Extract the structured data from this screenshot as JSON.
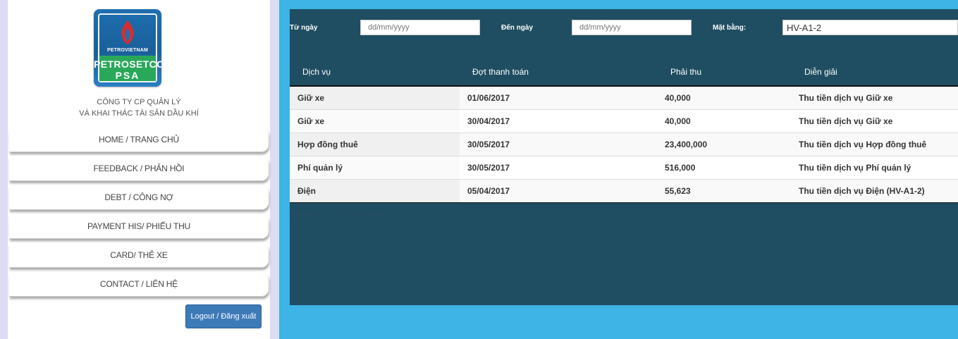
{
  "logo": {
    "brand_small": "PETROVIETNAM",
    "brand_main": "PETROSETCO",
    "brand_psa": "PSA"
  },
  "company": {
    "line1": "CÔNG TY CP QUẢN LÝ",
    "line2": "VÀ KHAI THÁC TÀI SẢN DẦU KHÍ"
  },
  "menu": {
    "items": [
      {
        "label": "HOME / TRANG CHỦ"
      },
      {
        "label": "FEEDBACK / PHẢN HỒI"
      },
      {
        "label": "DEBT / CÔNG NỢ"
      },
      {
        "label": "PAYMENT HIS/ PHIẾU THU"
      },
      {
        "label": "CARD/ THẺ XE"
      },
      {
        "label": "CONTACT / LIÊN HỆ"
      }
    ],
    "logout_label": "Logout / Đăng xuất"
  },
  "filters": {
    "from_label": "Từ ngày",
    "from_placeholder": "dd/mm/yyyy",
    "to_label": "Đến ngày",
    "to_placeholder": "dd/mm/yyyy",
    "unit_label": "Mặt bằng:",
    "unit_value": "HV-A1-2"
  },
  "table": {
    "columns": [
      "Dịch vụ",
      "Đợt thanh toán",
      "Phải thu",
      "Diễn giải"
    ],
    "rows": [
      [
        "Giữ xe",
        "01/06/2017",
        "40,000",
        "Thu tiền dịch vụ Giữ xe"
      ],
      [
        "Giữ xe",
        "30/04/2017",
        "40,000",
        "Thu tiền dịch vụ Giữ xe"
      ],
      [
        "Hợp đồng thuê",
        "30/05/2017",
        "23,400,000",
        "Thu tiền dịch vụ Hợp đồng thuê"
      ],
      [
        "Phí quản lý",
        "30/05/2017",
        "516,000",
        "Thu tiền dịch vụ Phí quản lý"
      ],
      [
        "Điện",
        "05/04/2017",
        "55,623",
        "Thu tiền dịch vụ Điện (HV-A1-2)"
      ]
    ],
    "info": "Showing 1 to 5 of 5 entries"
  },
  "colors": {
    "background": "#3eb3e6",
    "panel": "#1f4d61",
    "button": "#3d7ab8",
    "row_odd": "#f2f2f2",
    "row_even": "#f9f9f9"
  }
}
